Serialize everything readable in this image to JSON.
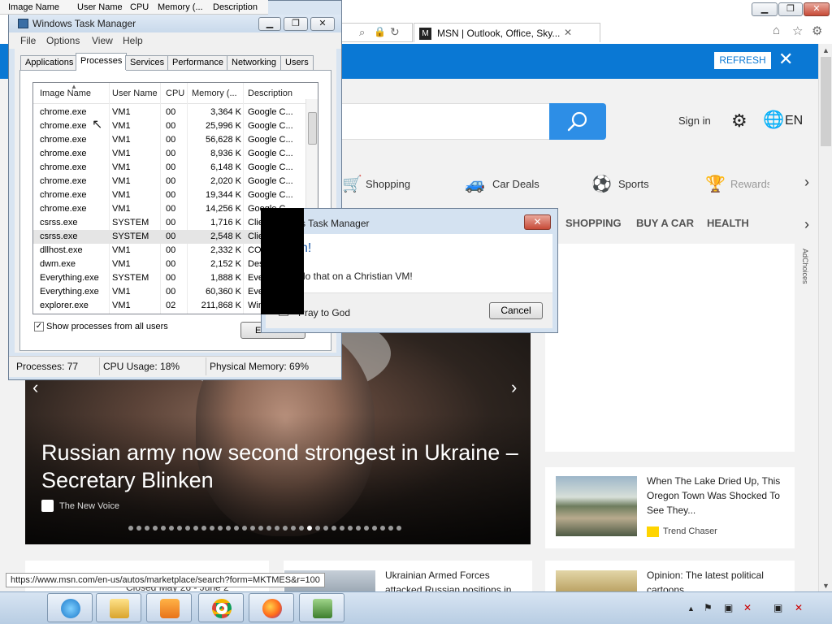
{
  "browser": {
    "tab_title": "MSN | Outlook, Office, Sky...",
    "tab_close": "✕",
    "favicon_text": "M",
    "window_buttons": {
      "minimize": "▁",
      "maximize": "❐",
      "close": "✕"
    },
    "toolbar_icons": [
      "home-icon",
      "star-icon",
      "gear-icon"
    ],
    "address_icons": [
      "search-icon",
      "lock-icon",
      "refresh-icon"
    ]
  },
  "msn": {
    "refresh_label": "REFRESH",
    "refresh_close": "✕",
    "sign_in": "Sign in",
    "lang": "EN",
    "nav": [
      {
        "label": "Shopping",
        "icon": "cart-icon"
      },
      {
        "label": "Car Deals",
        "icon": "car-icon"
      },
      {
        "label": "Sports",
        "icon": "soccer-icon"
      },
      {
        "label": "Rewards",
        "icon": "trophy-icon"
      }
    ],
    "nav_next": "›",
    "categories": [
      "SHOPPING",
      "BUY A CAR",
      "HEALTH"
    ],
    "cat_next": "›",
    "adchoices": "AdChoices",
    "hero": {
      "title": "Russian army now second strongest in Ukraine – Secretary Blinken",
      "source": "The New Voice",
      "prev": "‹",
      "next": "›",
      "dot_count": 34,
      "active_dot": 22
    },
    "card_lake": {
      "title": "When The Lake Dried Up, This Oregon Town Was Shocked To See They...",
      "source": "Trend Chaser"
    },
    "card_ua": {
      "title": "Ukrainian Armed Forces attacked Russian positions in"
    },
    "card_op": {
      "title": "Opinion: The latest political cartoons"
    },
    "closed_text": "Closed May 26 - June 2"
  },
  "status_url": "https://www.msn.com/en-us/autos/marketplace/search?form=MKTMES&r=100",
  "taskbar": {
    "apps": [
      "internet-explorer-icon",
      "file-explorer-icon",
      "media-player-icon",
      "chrome-icon",
      "firefox-icon",
      "task-manager-icon"
    ],
    "tray": [
      "▲",
      "⚑",
      "▣",
      "✕",
      "▣",
      "✕"
    ]
  },
  "task_manager": {
    "title": "Windows Task Manager",
    "bg_columns": [
      "Image Name",
      "User Name",
      "CPU",
      "Memory (...",
      "Description"
    ],
    "menu": [
      "File",
      "Options",
      "View",
      "Help"
    ],
    "tabs": [
      "Applications",
      "Processes",
      "Services",
      "Performance",
      "Networking",
      "Users"
    ],
    "active_tab": "Processes",
    "columns": [
      "Image Name",
      "User Name",
      "CPU",
      "Memory (...",
      "Description"
    ],
    "processes": [
      {
        "name": "chrome.exe",
        "user": "VM1",
        "cpu": "00",
        "mem": "3,364 K",
        "desc": "Google C..."
      },
      {
        "name": "chrome.exe",
        "user": "VM1",
        "cpu": "00",
        "mem": "25,996 K",
        "desc": "Google C..."
      },
      {
        "name": "chrome.exe",
        "user": "VM1",
        "cpu": "00",
        "mem": "56,628 K",
        "desc": "Google C..."
      },
      {
        "name": "chrome.exe",
        "user": "VM1",
        "cpu": "00",
        "mem": "8,936 K",
        "desc": "Google C..."
      },
      {
        "name": "chrome.exe",
        "user": "VM1",
        "cpu": "00",
        "mem": "6,148 K",
        "desc": "Google C..."
      },
      {
        "name": "chrome.exe",
        "user": "VM1",
        "cpu": "00",
        "mem": "2,020 K",
        "desc": "Google C..."
      },
      {
        "name": "chrome.exe",
        "user": "VM1",
        "cpu": "00",
        "mem": "19,344 K",
        "desc": "Google C..."
      },
      {
        "name": "chrome.exe",
        "user": "VM1",
        "cpu": "00",
        "mem": "14,256 K",
        "desc": "Google C..."
      },
      {
        "name": "csrss.exe",
        "user": "SYSTEM",
        "cpu": "00",
        "mem": "1,716 K",
        "desc": "Clie..."
      },
      {
        "name": "csrss.exe",
        "user": "SYSTEM",
        "cpu": "00",
        "mem": "2,548 K",
        "desc": "Clie..."
      },
      {
        "name": "dllhost.exe",
        "user": "VM1",
        "cpu": "00",
        "mem": "2,332 K",
        "desc": "CO..."
      },
      {
        "name": "dwm.exe",
        "user": "VM1",
        "cpu": "00",
        "mem": "2,152 K",
        "desc": "Des..."
      },
      {
        "name": "Everything.exe",
        "user": "SYSTEM",
        "cpu": "00",
        "mem": "1,888 K",
        "desc": "Eve..."
      },
      {
        "name": "Everything.exe",
        "user": "VM1",
        "cpu": "00",
        "mem": "60,360 K",
        "desc": "Eve..."
      },
      {
        "name": "explorer.exe",
        "user": "VM1",
        "cpu": "02",
        "mem": "211,868 K",
        "desc": "Win..."
      }
    ],
    "selected_row": 9,
    "show_all_label": "Show processes from all users",
    "show_all_checked": "✓",
    "end_button": "E",
    "status": {
      "processes": "Processes: 77",
      "cpu": "CPU Usage: 18%",
      "memory": "Physical Memory: 69%"
    }
  },
  "dialog": {
    "title": "vs Task Manager",
    "close": "✕",
    "heading": "h!",
    "message": "do that on a Christian VM!",
    "checkbox_label": "Pray to God",
    "checkbox_mark": "✓",
    "cancel": "Cancel"
  }
}
